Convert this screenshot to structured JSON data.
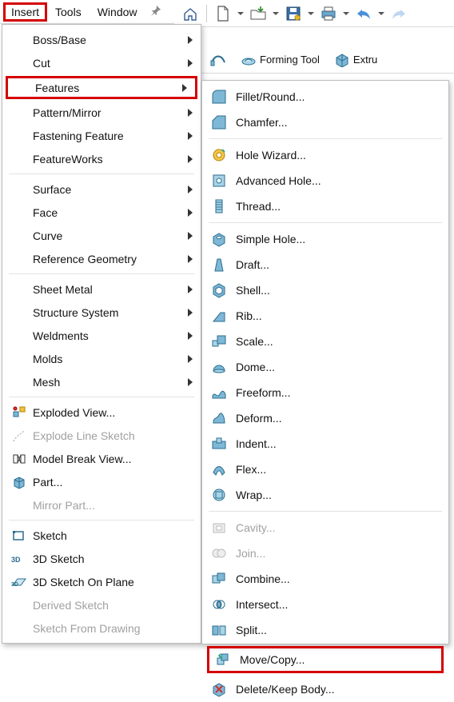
{
  "menubar": {
    "items": [
      "Insert",
      "Tools",
      "Window"
    ],
    "highlight_index": 0
  },
  "toolbar": {
    "home": "home",
    "newdoc": "new",
    "open": "open",
    "save": "save",
    "print": "print",
    "undo": "undo",
    "redo": "redo"
  },
  "ribbon": {
    "items": [
      {
        "label": "",
        "icon": "swept"
      },
      {
        "label": "Forming Tool",
        "icon": "forming"
      },
      {
        "label": "Extru",
        "icon": "extrude"
      }
    ]
  },
  "insert_menu": {
    "groups": [
      [
        {
          "label": "Boss/Base",
          "submenu": true
        },
        {
          "label": "Cut",
          "submenu": true
        },
        {
          "label": "Features",
          "submenu": true,
          "highlight": true
        },
        {
          "label": "Pattern/Mirror",
          "submenu": true
        },
        {
          "label": "Fastening Feature",
          "submenu": true
        },
        {
          "label": "FeatureWorks",
          "submenu": true
        }
      ],
      [
        {
          "label": "Surface",
          "submenu": true
        },
        {
          "label": "Face",
          "submenu": true
        },
        {
          "label": "Curve",
          "submenu": true
        },
        {
          "label": "Reference Geometry",
          "submenu": true
        }
      ],
      [
        {
          "label": "Sheet Metal",
          "submenu": true
        },
        {
          "label": "Structure System",
          "submenu": true
        },
        {
          "label": "Weldments",
          "submenu": true
        },
        {
          "label": "Molds",
          "submenu": true
        },
        {
          "label": "Mesh",
          "submenu": true
        }
      ],
      [
        {
          "label": "Exploded View...",
          "icon": "exploded"
        },
        {
          "label": "Explode Line Sketch",
          "icon": "explodeline",
          "disabled": true
        },
        {
          "label": "Model Break View...",
          "icon": "modelbreak"
        },
        {
          "label": "Part...",
          "icon": "part"
        },
        {
          "label": "Mirror Part...",
          "disabled": true
        }
      ],
      [
        {
          "label": "Sketch",
          "icon": "sketch"
        },
        {
          "label": "3D Sketch",
          "icon": "sketch3d"
        },
        {
          "label": "3D Sketch On Plane",
          "icon": "sketch3dplane"
        },
        {
          "label": "Derived Sketch",
          "disabled": true
        },
        {
          "label": "Sketch From Drawing",
          "disabled": true
        }
      ]
    ]
  },
  "features_submenu": {
    "groups": [
      [
        {
          "label": "Fillet/Round...",
          "icon": "fillet"
        },
        {
          "label": "Chamfer...",
          "icon": "chamfer"
        }
      ],
      [
        {
          "label": "Hole Wizard...",
          "icon": "holewizard"
        },
        {
          "label": "Advanced Hole...",
          "icon": "advhole"
        },
        {
          "label": "Thread...",
          "icon": "thread"
        }
      ],
      [
        {
          "label": "Simple Hole...",
          "icon": "simplehole"
        },
        {
          "label": "Draft...",
          "icon": "draft"
        },
        {
          "label": "Shell...",
          "icon": "shell"
        },
        {
          "label": "Rib...",
          "icon": "rib"
        },
        {
          "label": "Scale...",
          "icon": "scale"
        },
        {
          "label": "Dome...",
          "icon": "dome"
        },
        {
          "label": "Freeform...",
          "icon": "freeform"
        },
        {
          "label": "Deform...",
          "icon": "deform"
        },
        {
          "label": "Indent...",
          "icon": "indent"
        },
        {
          "label": "Flex...",
          "icon": "flex"
        },
        {
          "label": "Wrap...",
          "icon": "wrap"
        }
      ],
      [
        {
          "label": "Cavity...",
          "icon": "cavity",
          "disabled": true
        },
        {
          "label": "Join...",
          "icon": "join",
          "disabled": true
        },
        {
          "label": "Combine...",
          "icon": "combine"
        },
        {
          "label": "Intersect...",
          "icon": "intersect"
        },
        {
          "label": "Split...",
          "icon": "split"
        },
        {
          "label": "Move/Copy...",
          "icon": "movecopy",
          "highlight": true
        },
        {
          "label": "Delete/Keep Body...",
          "icon": "deletebody"
        }
      ]
    ]
  }
}
